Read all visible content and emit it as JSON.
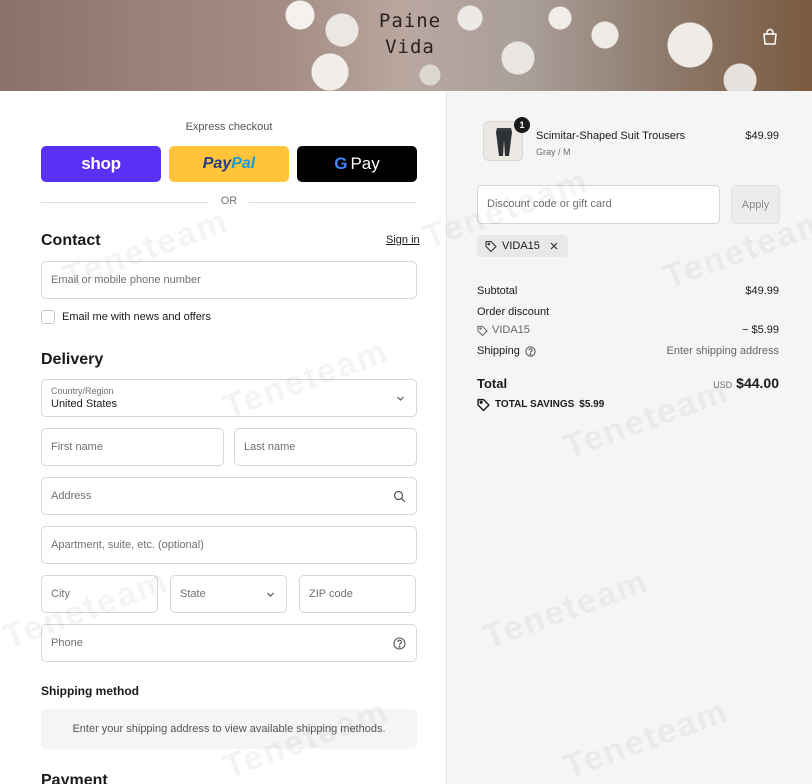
{
  "header": {
    "logo_line1": "Paine",
    "logo_line2": "Vida",
    "cart_icon": "bag-icon"
  },
  "express": {
    "title": "Express checkout",
    "shop_label": "shop",
    "paypal_a": "Pay",
    "paypal_b": "Pal",
    "gpay_g": "G",
    "gpay_label": "Pay",
    "or_label": "OR"
  },
  "contact": {
    "heading": "Contact",
    "signin_label": "Sign in",
    "email_placeholder": "Email or mobile phone number",
    "news_label": "Email me with news and offers"
  },
  "delivery": {
    "heading": "Delivery",
    "country_label": "Country/Region",
    "country_value": "United States",
    "first_name": "First name",
    "last_name": "Last name",
    "address": "Address",
    "apartment": "Apartment, suite, etc. (optional)",
    "city": "City",
    "state": "State",
    "zip": "ZIP code",
    "phone": "Phone"
  },
  "shipping": {
    "heading": "Shipping method",
    "message": "Enter your shipping address to view available shipping methods."
  },
  "payment": {
    "heading": "Payment"
  },
  "summary": {
    "item": {
      "quantity": "1",
      "name": "Scimitar-Shaped Suit Trousers",
      "variant": "Gray / M",
      "price": "$49.99"
    },
    "discount_placeholder": "Discount code or gift card",
    "apply_label": "Apply",
    "applied_code": "VIDA15",
    "subtotal_label": "Subtotal",
    "subtotal_value": "$49.99",
    "order_discount_label": "Order discount",
    "discount_code": "VIDA15",
    "discount_value": "− $5.99",
    "shipping_label": "Shipping",
    "shipping_value": "Enter shipping address",
    "total_label": "Total",
    "currency": "USD",
    "total_value": "$44.00",
    "savings_label": "TOTAL SAVINGS",
    "savings_value": "$5.99"
  },
  "watermark": "Teneteam",
  "colors": {
    "shop": "#5a31f4",
    "paypal": "#ffc439",
    "gpay": "#000000",
    "summary_bg": "#f5f5f5"
  }
}
